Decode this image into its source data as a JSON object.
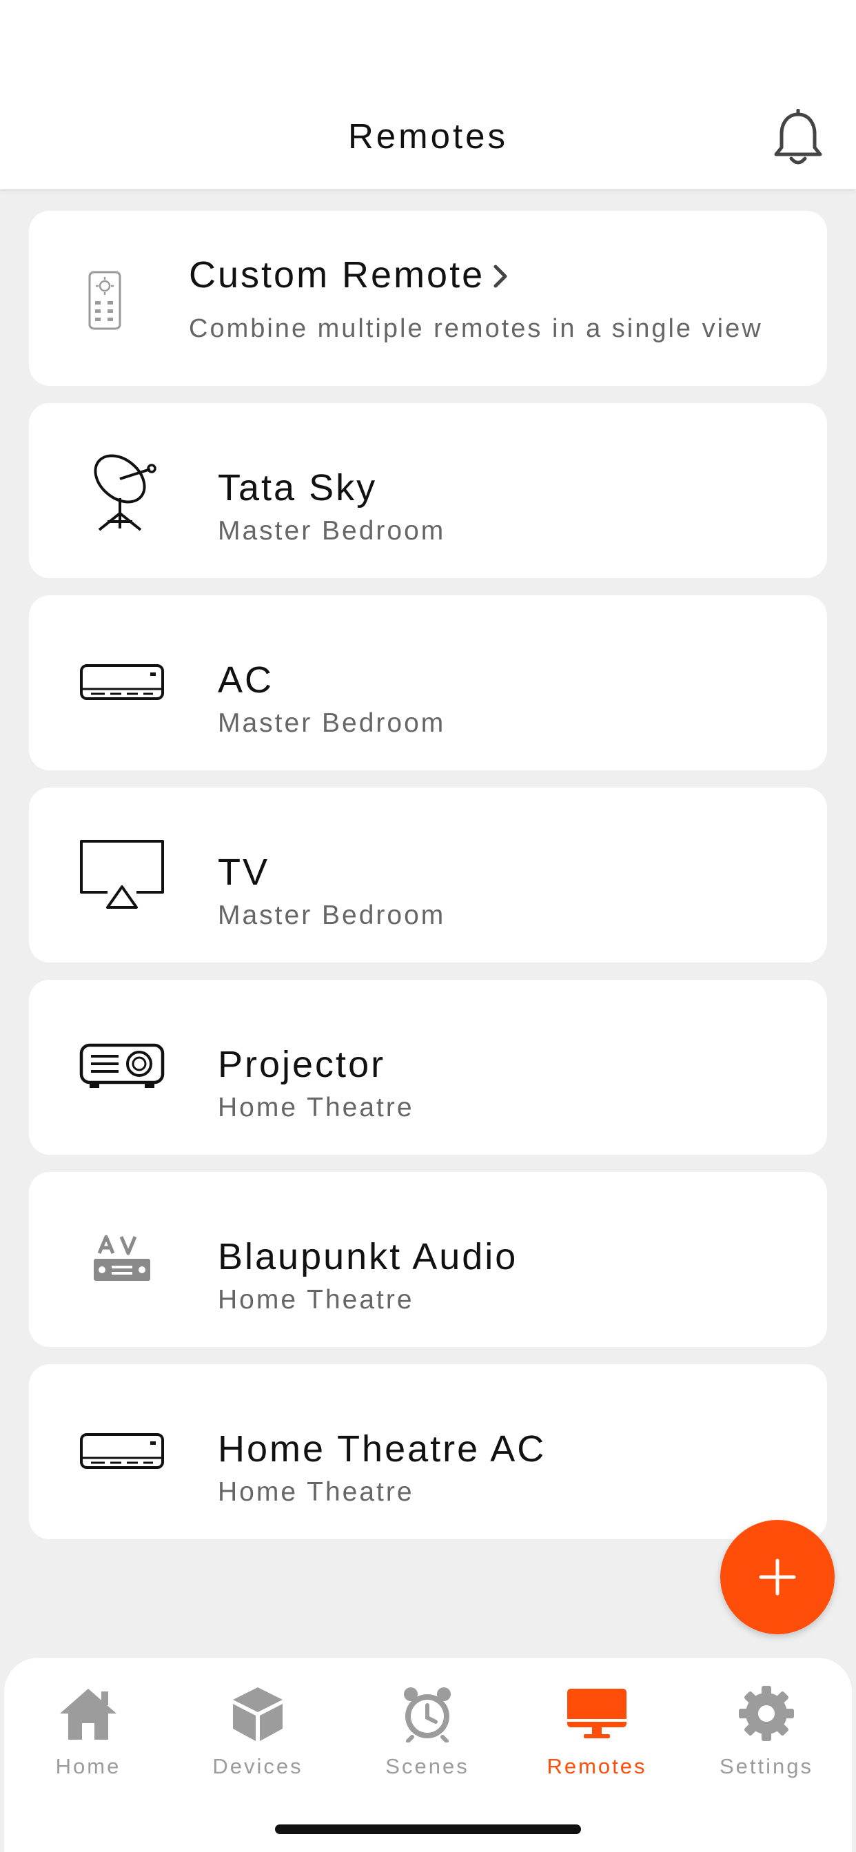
{
  "header": {
    "title": "Remotes"
  },
  "custom_remote": {
    "title": "Custom Remote",
    "subtitle": "Combine multiple remotes in a single view",
    "icon": "remote-control-icon"
  },
  "remotes": [
    {
      "name": "Tata Sky",
      "room": "Master Bedroom",
      "icon": "satellite-dish-icon"
    },
    {
      "name": "AC",
      "room": "Master Bedroom",
      "icon": "air-conditioner-icon"
    },
    {
      "name": "TV",
      "room": "Master Bedroom",
      "icon": "tv-icon"
    },
    {
      "name": "Projector",
      "room": "Home Theatre",
      "icon": "projector-icon"
    },
    {
      "name": "Blaupunkt Audio",
      "room": "Home Theatre",
      "icon": "av-receiver-icon"
    },
    {
      "name": "Home Theatre AC",
      "room": "Home Theatre",
      "icon": "air-conditioner-icon"
    }
  ],
  "tabs": [
    {
      "label": "Home",
      "icon": "home-icon",
      "active": false
    },
    {
      "label": "Devices",
      "icon": "cube-icon",
      "active": false
    },
    {
      "label": "Scenes",
      "icon": "alarm-clock-icon",
      "active": false
    },
    {
      "label": "Remotes",
      "icon": "monitor-icon",
      "active": true
    },
    {
      "label": "Settings",
      "icon": "gear-icon",
      "active": false
    }
  ],
  "colors": {
    "accent": "#ff4d0a",
    "background": "#efefef",
    "card": "#ffffff",
    "inactive_tab": "#9c9c9c"
  }
}
